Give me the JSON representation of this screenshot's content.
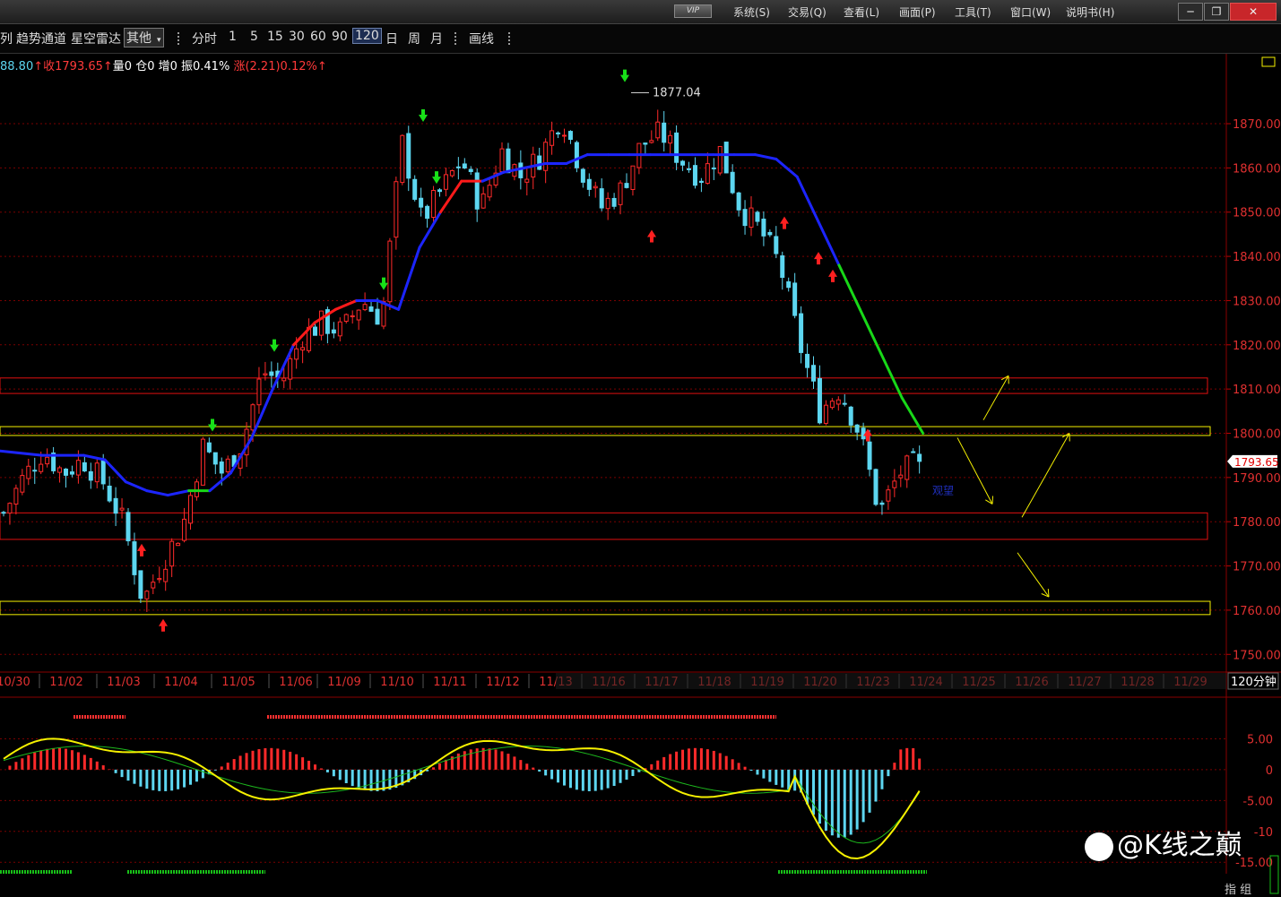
{
  "titlebar": {
    "vip_label": "VIP",
    "menu": [
      "系统(S)",
      "交易(Q)",
      "查看(L)",
      "画面(P)",
      "工具(T)",
      "窗口(W)",
      "说明书(H)"
    ],
    "window_buttons": [
      "─",
      "❐",
      "✕"
    ]
  },
  "toolbar": {
    "items": [
      "列",
      "趋势通道",
      "星空雷达"
    ],
    "dropdown_label": "其他",
    "period_label": "分时",
    "periods": [
      "1",
      "5",
      "15",
      "30",
      "60",
      "90",
      "120",
      "日",
      "周",
      "月"
    ],
    "selected_period": "120",
    "draw_label": "画线"
  },
  "infoline": {
    "open_frag": "88.80",
    "arrow1": "↑",
    "close_label": "收1793.65",
    "arrow2": "↑",
    "rest": "量0  仓0  增0  振0.41%",
    "change": "涨(2.21)0.12%↑"
  },
  "colors": {
    "up": "#ff2a2a",
    "down": "#5dd6f0",
    "ma_blue": "#1c25ff",
    "ma_green": "#18d818",
    "yellow": "#f5f000",
    "grid": "#7a0000"
  },
  "chart_data": {
    "type": "candlestick",
    "price_axis": {
      "ticks": [
        1750,
        1760,
        1770,
        1780,
        1790,
        1800,
        1810,
        1820,
        1830,
        1840,
        1850,
        1860,
        1870
      ],
      "tick_labels": [
        "1750.00",
        "1760.00",
        "1770.00",
        "1780.00",
        "1790.00",
        "1800.00",
        "1810.00",
        "1820.00",
        "1830.00",
        "1840.00",
        "1850.00",
        "1860.00",
        "1870.00"
      ],
      "ylim": [
        1746,
        1885
      ],
      "last_price_label": "1793.65"
    },
    "date_axis": {
      "labels": [
        "10/30",
        "11/02",
        "11/03",
        "11/04",
        "11/05",
        "11/06",
        "11/09",
        "11/10",
        "11/11",
        "11/12",
        "11/13",
        "11/16",
        "11/17",
        "11/18",
        "11/19",
        "11/20",
        "11/23",
        "11/24",
        "11/25",
        "11/26",
        "11/27",
        "11/28",
        "11/29"
      ],
      "period_label": "120分钟"
    },
    "peak_annotation": "1877.04",
    "note_label": "观望",
    "close_path": [
      [
        "10/30",
        1782
      ],
      [
        "10/30",
        1790
      ],
      [
        "11/02",
        1796
      ],
      [
        "11/02",
        1791
      ],
      [
        "11/02",
        1794
      ],
      [
        "11/03",
        1789
      ],
      [
        "11/03",
        1780
      ],
      [
        "11/03",
        1762
      ],
      [
        "11/04",
        1771
      ],
      [
        "11/04",
        1779
      ],
      [
        "11/04",
        1797
      ],
      [
        "11/05",
        1791
      ],
      [
        "11/05",
        1798
      ],
      [
        "11/05",
        1814
      ],
      [
        "11/06",
        1812
      ],
      [
        "11/06",
        1822
      ],
      [
        "11/09",
        1825
      ],
      [
        "11/09",
        1823
      ],
      [
        "11/10",
        1830
      ],
      [
        "11/10",
        1826
      ],
      [
        "11/10",
        1866
      ],
      [
        "11/11",
        1848
      ],
      [
        "11/11",
        1855
      ],
      [
        "11/12",
        1862
      ],
      [
        "11/12",
        1851
      ],
      [
        "11/13",
        1864
      ],
      [
        "11/13",
        1858
      ],
      [
        "11/16",
        1863
      ],
      [
        "11/16",
        1872
      ],
      [
        "11/17",
        1860
      ],
      [
        "11/17",
        1851
      ],
      [
        "11/17",
        1855
      ],
      [
        "11/18",
        1865
      ],
      [
        "11/18",
        1868
      ],
      [
        "11/19",
        1862
      ],
      [
        "11/19",
        1858
      ],
      [
        "11/19",
        1864
      ],
      [
        "11/20",
        1851
      ],
      [
        "11/20",
        1846
      ],
      [
        "11/20",
        1838
      ],
      [
        "11/20",
        1820
      ],
      [
        "11/23",
        1805
      ],
      [
        "11/23",
        1810
      ],
      [
        "11/23",
        1800
      ],
      [
        "11/24",
        1782
      ],
      [
        "11/24",
        1791
      ],
      [
        "11/24",
        1793.65
      ]
    ],
    "band_line": [
      [
        0,
        1796
      ],
      [
        2,
        1795
      ],
      [
        4,
        1795
      ],
      [
        5,
        1794
      ],
      [
        6,
        1789
      ],
      [
        7,
        1787
      ],
      [
        8,
        1786
      ],
      [
        9,
        1787
      ],
      [
        10,
        1787
      ],
      [
        11,
        1791
      ],
      [
        12,
        1799
      ],
      [
        13,
        1810
      ],
      [
        14,
        1820
      ],
      [
        15,
        1825
      ],
      [
        16,
        1828
      ],
      [
        17,
        1830
      ],
      [
        18,
        1830
      ],
      [
        19,
        1828
      ],
      [
        20,
        1842
      ],
      [
        21,
        1850
      ],
      [
        22,
        1857
      ],
      [
        23,
        1857
      ],
      [
        24,
        1859
      ],
      [
        25,
        1860
      ],
      [
        26,
        1861
      ],
      [
        27,
        1861
      ],
      [
        28,
        1863
      ],
      [
        29,
        1863
      ],
      [
        30,
        1863
      ],
      [
        31,
        1863
      ],
      [
        32,
        1863
      ],
      [
        33,
        1863
      ],
      [
        34,
        1863
      ],
      [
        35,
        1863
      ],
      [
        36,
        1863
      ],
      [
        37,
        1862
      ],
      [
        38,
        1858
      ],
      [
        39,
        1848
      ],
      [
        40,
        1838
      ],
      [
        41,
        1828
      ],
      [
        42,
        1818
      ],
      [
        43,
        1808
      ],
      [
        44,
        1800
      ]
    ],
    "zones": {
      "red_boxes": [
        [
          1809,
          1812.5
        ],
        [
          1776,
          1782
        ]
      ],
      "yellow_boxes": [
        [
          1799.5,
          1801.5
        ],
        [
          1759,
          1762
        ]
      ]
    },
    "indicator": {
      "ticks": [
        5,
        0,
        -5,
        -10,
        -15
      ],
      "tick_labels": [
        "5.00",
        "0",
        "-5.00",
        "-10",
        "-15.00"
      ],
      "ylim": [
        -17,
        10
      ]
    }
  },
  "bottom": {
    "tab_label": "指 组"
  },
  "watermark": {
    "text": "@K线之巅"
  }
}
